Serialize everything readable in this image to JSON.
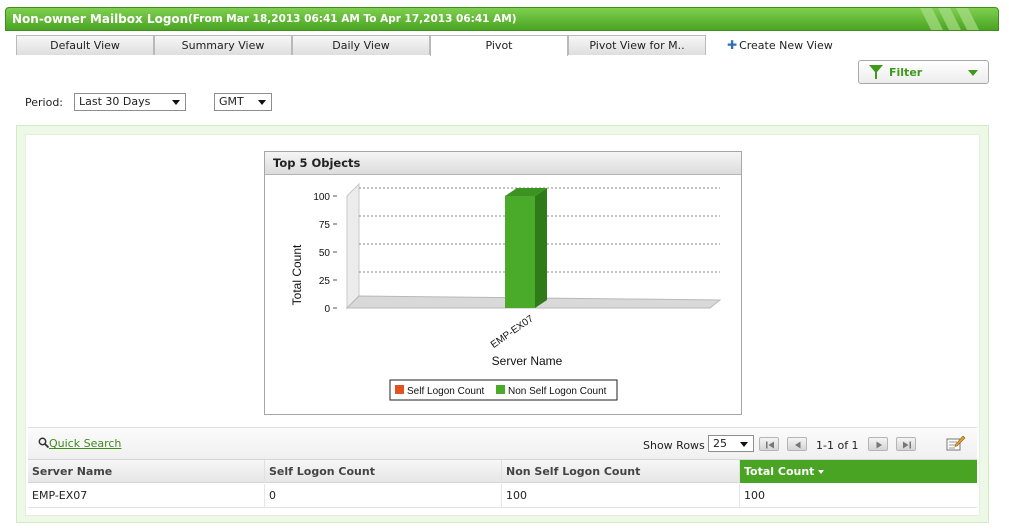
{
  "header": {
    "title": "Non-owner Mailbox Logon",
    "range": "(From Mar 18,2013 06:41 AM To Apr 17,2013 06:41 AM)"
  },
  "tabs": [
    {
      "label": "Default View"
    },
    {
      "label": "Summary View"
    },
    {
      "label": "Daily View"
    },
    {
      "label": "Pivot",
      "active": true
    },
    {
      "label": "Pivot View for M.."
    }
  ],
  "create_view_label": "Create New View",
  "filter_label": "Filter",
  "period": {
    "label": "Period:",
    "value": "Last 30 Days",
    "timezone": "GMT"
  },
  "chart_panel_title": "Top 5 Objects",
  "chart_data": {
    "type": "bar",
    "categories": [
      "EMP-EX07"
    ],
    "series": [
      {
        "name": "Self Logon Count",
        "values": [
          0
        ],
        "color": "#e0521f"
      },
      {
        "name": "Non Self Logon Count",
        "values": [
          100
        ],
        "color": "#4aaa2a"
      }
    ],
    "xlabel": "Server Name",
    "ylabel": "Total Count",
    "yticks": [
      "0",
      "25",
      "50",
      "75",
      "100"
    ],
    "ylim": [
      0,
      100
    ],
    "grid": true,
    "legend": "bottom"
  },
  "grid_toolbar": {
    "quick_search": "Quick Search",
    "show_rows_label": "Show Rows",
    "show_rows_value": "25",
    "page_info": "1-1 of 1"
  },
  "table": {
    "columns": [
      "Server Name",
      "Self Logon Count",
      "Non Self Logon Count",
      "Total Count"
    ],
    "rows": [
      [
        "EMP-EX07",
        "0",
        "100",
        "100"
      ]
    ]
  }
}
